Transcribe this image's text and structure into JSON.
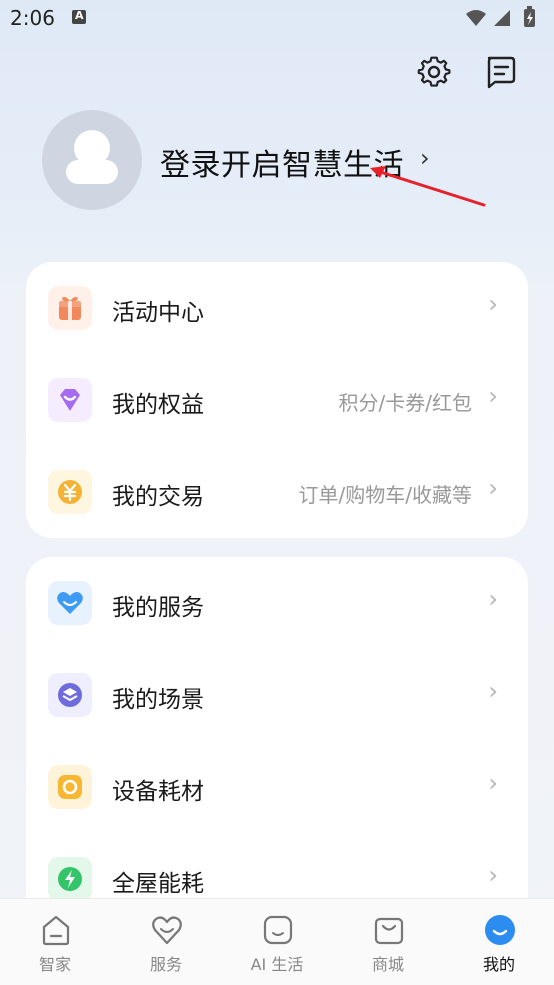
{
  "status_bar": {
    "time": "2:06"
  },
  "header": {
    "icons": [
      "gear-icon",
      "message-icon"
    ]
  },
  "profile": {
    "login_text": "登录开启智慧生活",
    "chevron": "›"
  },
  "colors": {
    "annotation_arrow": "#e8202a",
    "active_tab": "#2d8cf0"
  },
  "card1": {
    "rows": [
      {
        "label": "活动中心",
        "sub": "",
        "icon": "gift-icon"
      },
      {
        "label": "我的权益",
        "sub": "积分/卡券/红包",
        "icon": "diamond-icon"
      },
      {
        "label": "我的交易",
        "sub": "订单/购物车/收藏等",
        "icon": "yen-coin-icon"
      }
    ]
  },
  "card2": {
    "rows": [
      {
        "label": "我的服务",
        "sub": "",
        "icon": "heart-icon"
      },
      {
        "label": "我的场景",
        "sub": "",
        "icon": "layers-icon"
      },
      {
        "label": "设备耗材",
        "sub": "",
        "icon": "ring-icon"
      },
      {
        "label": "全屋能耗",
        "sub": "",
        "icon": "lightning-icon"
      }
    ]
  },
  "bottom_nav": {
    "items": [
      {
        "label": "智家",
        "icon": "home-icon",
        "active": false
      },
      {
        "label": "服务",
        "icon": "heart-outline-icon",
        "active": false
      },
      {
        "label": "AI 生活",
        "icon": "ai-chat-icon",
        "active": false
      },
      {
        "label": "商城",
        "icon": "bag-icon",
        "active": false
      },
      {
        "label": "我的",
        "icon": "smile-icon",
        "active": true
      }
    ]
  }
}
